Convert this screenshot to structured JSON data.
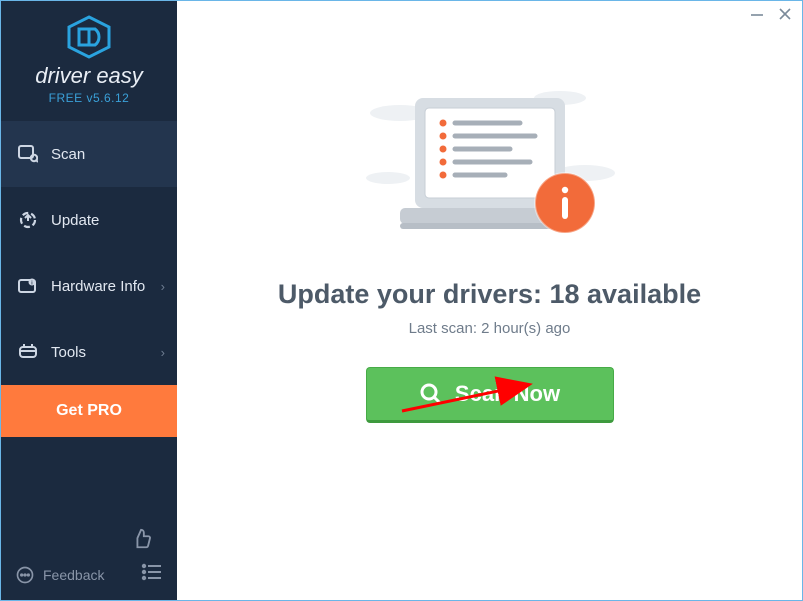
{
  "brand": "driver easy",
  "version": "FREE v5.6.12",
  "sidebar": {
    "items": [
      {
        "label": "Scan"
      },
      {
        "label": "Update"
      },
      {
        "label": "Hardware Info"
      },
      {
        "label": "Tools"
      }
    ],
    "get_pro": "Get PRO",
    "feedback": "Feedback"
  },
  "main": {
    "headline_prefix": "Update your drivers: ",
    "available_count": "18",
    "headline_suffix": " available",
    "last_scan": "Last scan: 2 hour(s) ago",
    "scan_button": "Scan Now"
  }
}
